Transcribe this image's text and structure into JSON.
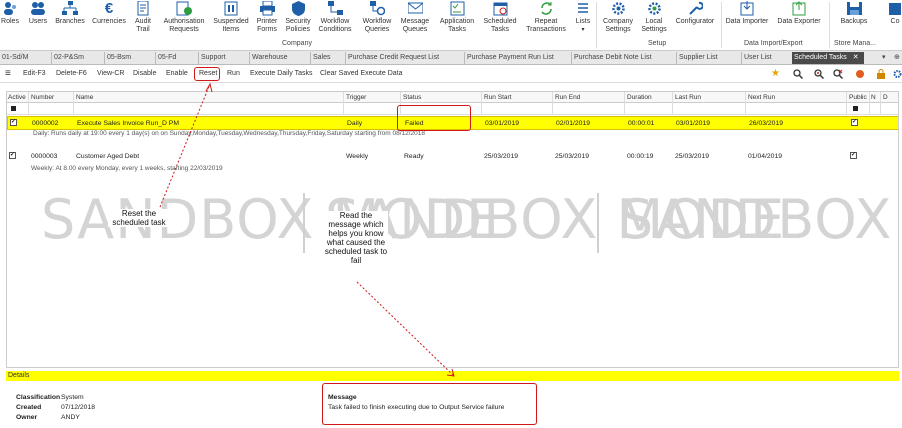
{
  "ribbon": {
    "buttons": [
      {
        "label": "Roles",
        "icon": "roles-icon"
      },
      {
        "label": "Users",
        "icon": "users-icon"
      },
      {
        "label": "Branches",
        "icon": "branches-icon"
      },
      {
        "label": "Currencies",
        "icon": "currencies-icon"
      },
      {
        "label": "Audit\nTrail",
        "icon": "audit-trail-icon"
      },
      {
        "label": "Authorisation\nRequests",
        "icon": "authorisation-icon"
      },
      {
        "label": "Suspended\nItems",
        "icon": "suspended-items-icon"
      },
      {
        "label": "Printer\nForms",
        "icon": "printer-icon"
      },
      {
        "label": "Security\nPolicies",
        "icon": "security-policies-icon"
      },
      {
        "label": "Workflow\nConditions",
        "icon": "workflow-conditions-icon"
      },
      {
        "label": "Workflow\nQueries",
        "icon": "workflow-queries-icon"
      },
      {
        "label": "Message\nQueues",
        "icon": "message-queues-icon"
      },
      {
        "label": "Application\nTasks",
        "icon": "application-tasks-icon"
      },
      {
        "label": "Scheduled\nTasks",
        "icon": "scheduled-tasks-icon"
      },
      {
        "label": "Repeat\nTransactions",
        "icon": "repeat-transactions-icon"
      },
      {
        "label": "Lists",
        "icon": "lists-icon"
      },
      {
        "label": "Company\nSettings",
        "icon": "company-settings-icon"
      },
      {
        "label": "Local\nSettings",
        "icon": "local-settings-icon"
      },
      {
        "label": "Configurator",
        "icon": "configurator-icon"
      },
      {
        "label": "Data Importer",
        "icon": "data-importer-icon"
      },
      {
        "label": "Data Exporter",
        "icon": "data-exporter-icon"
      },
      {
        "label": "Backups",
        "icon": "backups-icon"
      },
      {
        "label": "Co",
        "icon": "co-icon"
      }
    ],
    "groups": {
      "company": "Company",
      "setup": "Setup",
      "data": "Data Import/Export",
      "store": "Store Mana..."
    }
  },
  "tabs": [
    "01-Sd/M",
    "02-P&Sm",
    "05-Bsm",
    "05-Fd",
    "Support",
    "Warehouse",
    "Sales",
    "Purchase Credit Request List",
    "Purchase Payment Run List",
    "Purchase Debit Note List",
    "Supplier List",
    "User List",
    "Scheduled Tasks"
  ],
  "active_tab_close": "✕",
  "toolbar": {
    "items": [
      "Edit-F3",
      "Delete-F6",
      "View-CR",
      "Disable",
      "Enable",
      "Reset",
      "Run",
      "Execute Daily Tasks",
      "Clear Saved Execute Data"
    ]
  },
  "grid": {
    "columns": [
      "Active",
      "Number",
      "Name",
      "Trigger",
      "Status",
      "Run Start",
      "Run End",
      "Duration",
      "Last Run",
      "Next Run",
      "Public",
      "N",
      "D"
    ],
    "rows": [
      {
        "active": "✓",
        "number": "0000002",
        "name": "Execute Sales Invoice Run_D PM",
        "trigger": "Daily",
        "status": "Failed",
        "run_start": "03/01/2019",
        "run_end": "02/01/2019",
        "duration": "00:00:01",
        "last_run": "03/01/2019",
        "next_run": "26/03/2019",
        "public": "✓",
        "description": "Daily: Runs daily at 19:00 every 1 day(s) on on Sunday,Monday,Tuesday,Wednesday,Thursday,Friday,Saturday starting from 08/12/2018"
      },
      {
        "active": "✓",
        "number": "0000003",
        "name": "Customer Aged Debt",
        "trigger": "Weekly",
        "status": "Ready",
        "run_start": "25/03/2019",
        "run_end": "25/03/2019",
        "duration": "00:00:19",
        "last_run": "25/03/2019",
        "next_run": "01/04/2019",
        "public": "✓",
        "description": "Weekly: At 8.00 every Monday, every 1 weeks, starting 22/03/2019"
      }
    ],
    "watermark": "SANDBOX MODE"
  },
  "details": {
    "title": "Details",
    "classification_label": "Classification",
    "classification": "System",
    "created_label": "Created",
    "created": "07/12/2018",
    "owner_label": "Owner",
    "owner": "ANDY",
    "message_label": "Message",
    "message": "Task failed to finish executing due to Output Service failure"
  },
  "annotations": {
    "reset": "Reset the scheduled task",
    "message": "Read the message which helps you know what caused the scheduled task to fail"
  },
  "colors": {
    "highlight": "#ffff00",
    "callout": "#d01818",
    "active_tab": "#4a4a4a"
  }
}
